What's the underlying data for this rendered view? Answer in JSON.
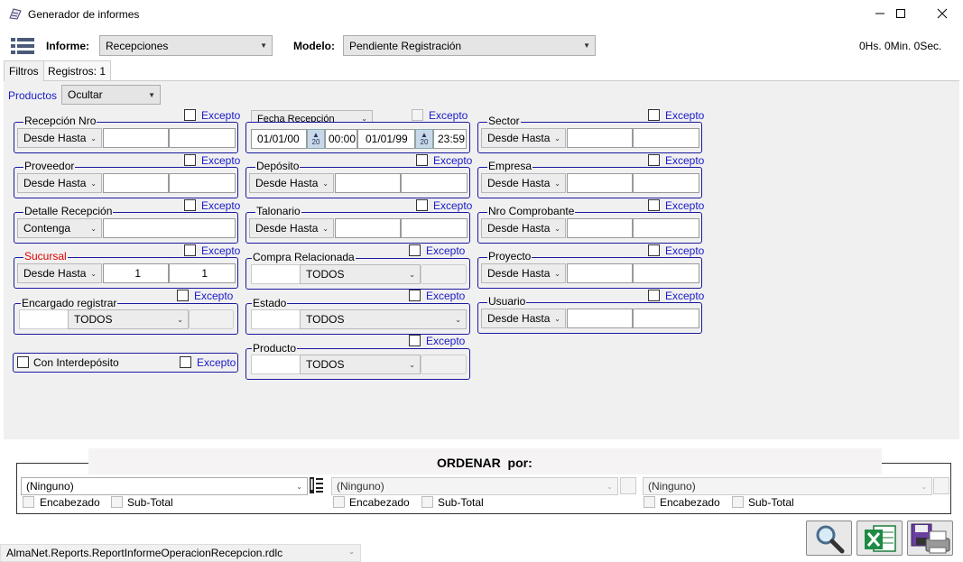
{
  "window": {
    "title": "Generador de informes",
    "timer": "0Hs. 0Min. 0Sec."
  },
  "header": {
    "informe_label": "Informe:",
    "informe_value": "Recepciones",
    "modelo_label": "Modelo:",
    "modelo_value": "Pendiente Registración"
  },
  "tabs": [
    {
      "label": "Filtros"
    },
    {
      "label": "Registros: 1"
    }
  ],
  "productos": {
    "label": "Productos",
    "value": "Ocultar"
  },
  "except_label": "Excepto",
  "filters": {
    "recepcion_nro": {
      "label": "Recepción Nro",
      "mode": "Desde Hasta",
      "from": "",
      "to": ""
    },
    "fecha_recepcion": {
      "label": "Fecha Recepción",
      "from_date": "01/01/00",
      "from_time": "00:00",
      "to_date": "01/01/99",
      "to_time": "23:59",
      "spin": "20"
    },
    "sector": {
      "label": "Sector",
      "mode": "Desde Hasta",
      "from": "",
      "to": ""
    },
    "proveedor": {
      "label": "Proveedor",
      "mode": "Desde Hasta",
      "from": "",
      "to": ""
    },
    "deposito": {
      "label": "Depósito",
      "mode": "Desde Hasta",
      "from": "",
      "to": ""
    },
    "empresa": {
      "label": "Empresa",
      "mode": "Desde Hasta",
      "from": "",
      "to": ""
    },
    "detalle_recepcion": {
      "label": "Detalle Recepción",
      "mode": "Contenga",
      "value": ""
    },
    "talonario": {
      "label": "Talonario",
      "mode": "Desde Hasta",
      "from": "",
      "to": ""
    },
    "nro_comprobante": {
      "label": "Nro Comprobante",
      "mode": "Desde Hasta",
      "from": "",
      "to": ""
    },
    "sucursal": {
      "label": "Sucursal",
      "mode": "Desde Hasta",
      "from": "1",
      "to": "1"
    },
    "compra_relacionada": {
      "label": "Compra Relacionada",
      "value": "TODOS"
    },
    "proyecto": {
      "label": "Proyecto",
      "mode": "Desde Hasta",
      "from": "",
      "to": ""
    },
    "encargado_registrar": {
      "label": "Encargado registrar",
      "value": "TODOS"
    },
    "estado": {
      "label": "Estado",
      "value": "TODOS"
    },
    "usuario": {
      "label": "Usuario",
      "mode": "Desde Hasta",
      "from": "",
      "to": ""
    },
    "con_interdeposito": {
      "label": "Con Interdepósito"
    },
    "producto": {
      "label": "Producto",
      "value": "TODOS"
    }
  },
  "ordenar": {
    "title": "ORDENAR  por:",
    "columns": [
      {
        "value": "(Ninguno)",
        "encabezado": "Encabezado",
        "subtotal": "Sub-Total"
      },
      {
        "value": "(Ninguno)",
        "encabezado": "Encabezado",
        "subtotal": "Sub-Total"
      },
      {
        "value": "(Ninguno)",
        "encabezado": "Encabezado",
        "subtotal": "Sub-Total"
      }
    ]
  },
  "report_file": "AlmaNet.Reports.ReportInformeOperacionRecepcion.rdlc",
  "colors": {
    "accent_border": "#1a1aa0",
    "link": "#1a1ac8",
    "required": "#e00000"
  }
}
